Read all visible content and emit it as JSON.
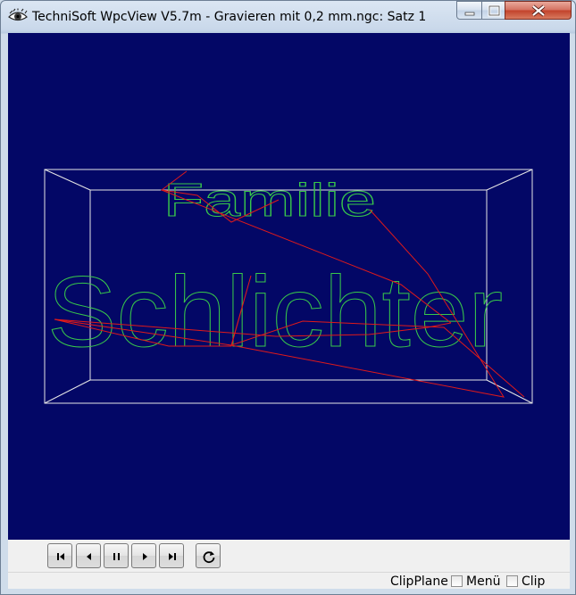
{
  "window": {
    "title": "TechniSoft WpcView V5.7m - Gravieren mit 0,2 mm.ngc: Satz 1",
    "icon": "eye-icon"
  },
  "viewport": {
    "background": "#030766",
    "text_line_1": "Familie",
    "text_line_2": "Schlichter",
    "engraving_color": "#38c84a",
    "toolpath_color": "#e01a1a",
    "box_color": "#e6e6e6"
  },
  "toolbar": {
    "buttons": [
      {
        "name": "first-block-button",
        "icon": "skip-to-start-icon"
      },
      {
        "name": "previous-block-button",
        "icon": "step-back-icon"
      },
      {
        "name": "pause-button",
        "icon": "pause-icon"
      },
      {
        "name": "next-block-button",
        "icon": "step-forward-icon"
      },
      {
        "name": "last-block-button",
        "icon": "skip-to-end-icon"
      },
      {
        "name": "rewind-button",
        "icon": "reload-icon"
      }
    ]
  },
  "statusbar": {
    "clipplane_label": "ClipPlane",
    "menu_label": "Menü",
    "menu_checked": false,
    "clip_label": "Clip",
    "clip_checked": false
  }
}
